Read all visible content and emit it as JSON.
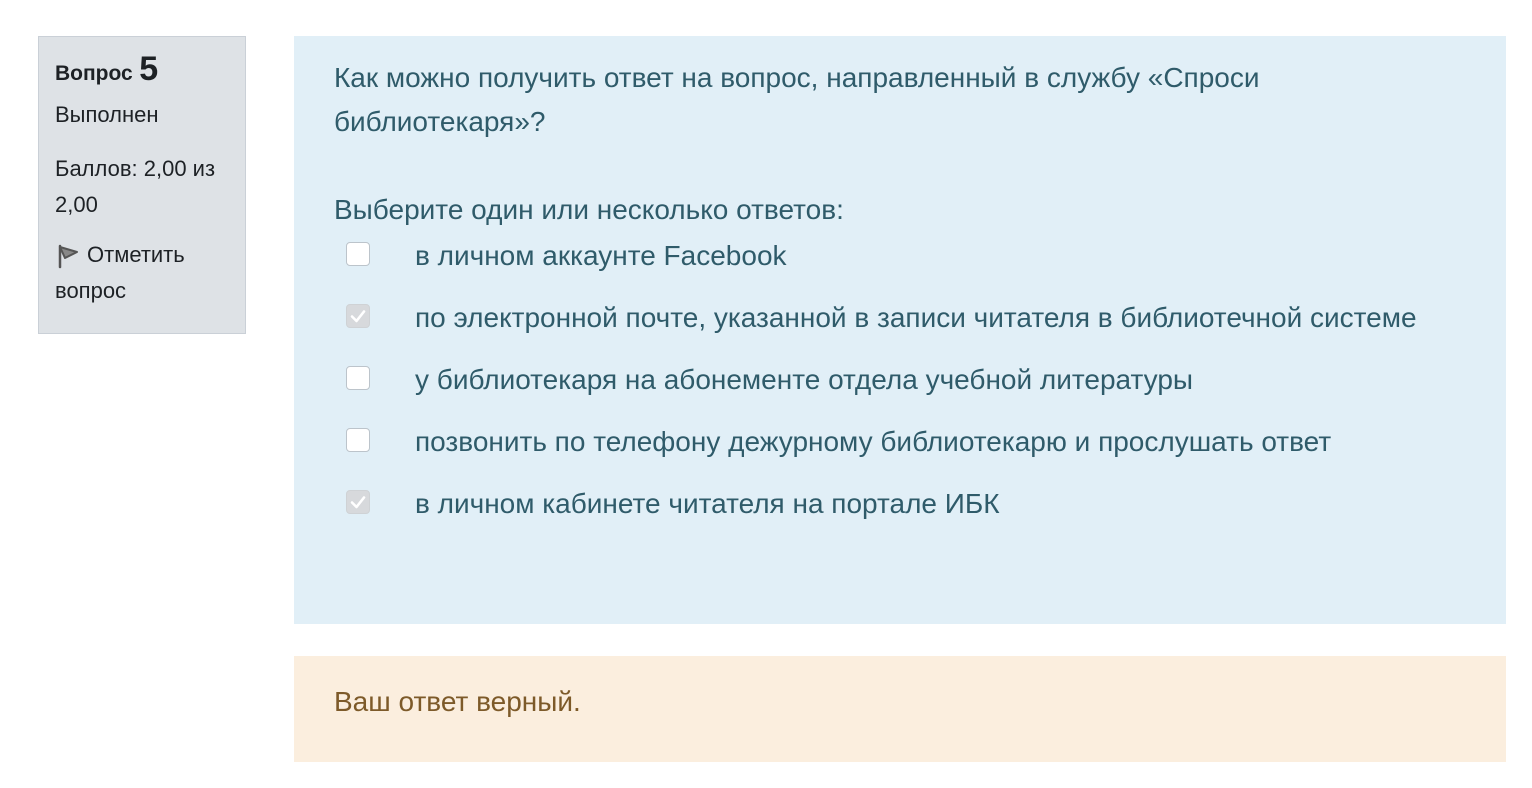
{
  "info": {
    "question_label": "Вопрос",
    "question_number": "5",
    "state": "Выполнен",
    "grade_line1": "Баллов: 2,00 из",
    "grade_line2": "2,00",
    "flag_label_line1": "Отметить",
    "flag_label_line2": "вопрос",
    "flag_icon": "flag-icon"
  },
  "question": {
    "text": "Как можно получить ответ на вопрос, направленный в службу «Спроси библиотекаря»?",
    "prompt": "Выберите один или несколько ответов:",
    "answers": [
      {
        "label": "в личном аккаунте Facebook",
        "checked": false
      },
      {
        "label": "по электронной почте, указанной в записи читателя в библиотечной системе",
        "checked": true
      },
      {
        "label": "у библиотекаря на абонементе отдела учебной литературы",
        "checked": false
      },
      {
        "label": "позвонить по телефону дежурному библиотекарю и прослушать ответ",
        "checked": false
      },
      {
        "label": "в личном кабинете читателя на портале ИБК",
        "checked": true
      }
    ]
  },
  "feedback": {
    "text": "Ваш ответ верный."
  },
  "colors": {
    "info_bg": "#dee2e6",
    "formulation_bg": "#e1eff7",
    "formulation_text": "#2f5b6a",
    "feedback_bg": "#fbeede",
    "feedback_text": "#7d5a29"
  }
}
